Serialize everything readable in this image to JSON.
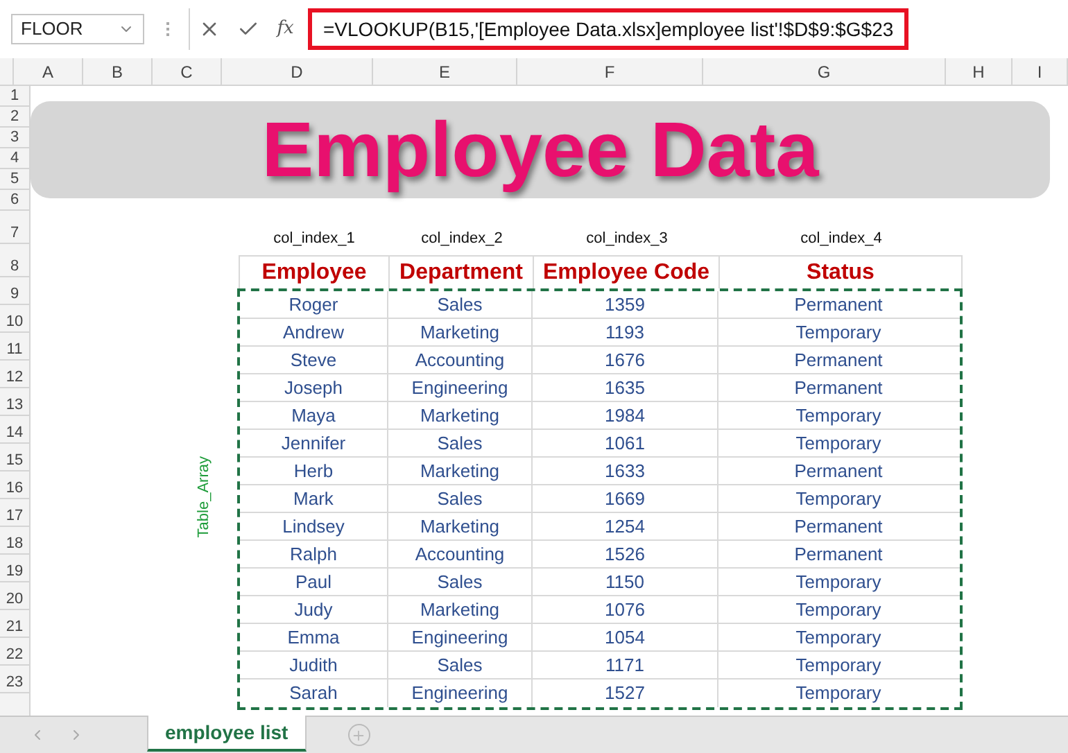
{
  "formula_bar": {
    "name_box": "FLOOR",
    "function_icon": "fx",
    "formula": "=VLOOKUP(B15,'[Employee Data.xlsx]employee list'!$D$9:$G$23"
  },
  "column_headers": [
    "A",
    "B",
    "C",
    "D",
    "E",
    "F",
    "G",
    "H",
    "I"
  ],
  "row_headers": [
    "1",
    "2",
    "3",
    "4",
    "5",
    "6",
    "7",
    "8",
    "9",
    "10",
    "11",
    "12",
    "13",
    "14",
    "15",
    "16",
    "17",
    "18",
    "19",
    "20",
    "21",
    "22",
    "23"
  ],
  "banner": {
    "title": "Employee Data"
  },
  "col_index_labels": [
    "col_index_1",
    "col_index_2",
    "col_index_3",
    "col_index_4"
  ],
  "range_label": "Table_Array",
  "table": {
    "columns": [
      "Employee",
      "Department",
      "Employee Code",
      "Status"
    ],
    "rows": [
      [
        "Roger",
        "Sales",
        "1359",
        "Permanent"
      ],
      [
        "Andrew",
        "Marketing",
        "1193",
        "Temporary"
      ],
      [
        "Steve",
        "Accounting",
        "1676",
        "Permanent"
      ],
      [
        "Joseph",
        "Engineering",
        "1635",
        "Permanent"
      ],
      [
        "Maya",
        "Marketing",
        "1984",
        "Temporary"
      ],
      [
        "Jennifer",
        "Sales",
        "1061",
        "Temporary"
      ],
      [
        "Herb",
        "Marketing",
        "1633",
        "Permanent"
      ],
      [
        "Mark",
        "Sales",
        "1669",
        "Temporary"
      ],
      [
        "Lindsey",
        "Marketing",
        "1254",
        "Permanent"
      ],
      [
        "Ralph",
        "Accounting",
        "1526",
        "Permanent"
      ],
      [
        "Paul",
        "Sales",
        "1150",
        "Temporary"
      ],
      [
        "Judy",
        "Marketing",
        "1076",
        "Temporary"
      ],
      [
        "Emma",
        "Engineering",
        "1054",
        "Temporary"
      ],
      [
        "Judith",
        "Sales",
        "1171",
        "Temporary"
      ],
      [
        "Sarah",
        "Engineering",
        "1527",
        "Temporary"
      ]
    ]
  },
  "sheet_tabs": [
    {
      "label": "employee list",
      "selected": true
    }
  ]
}
